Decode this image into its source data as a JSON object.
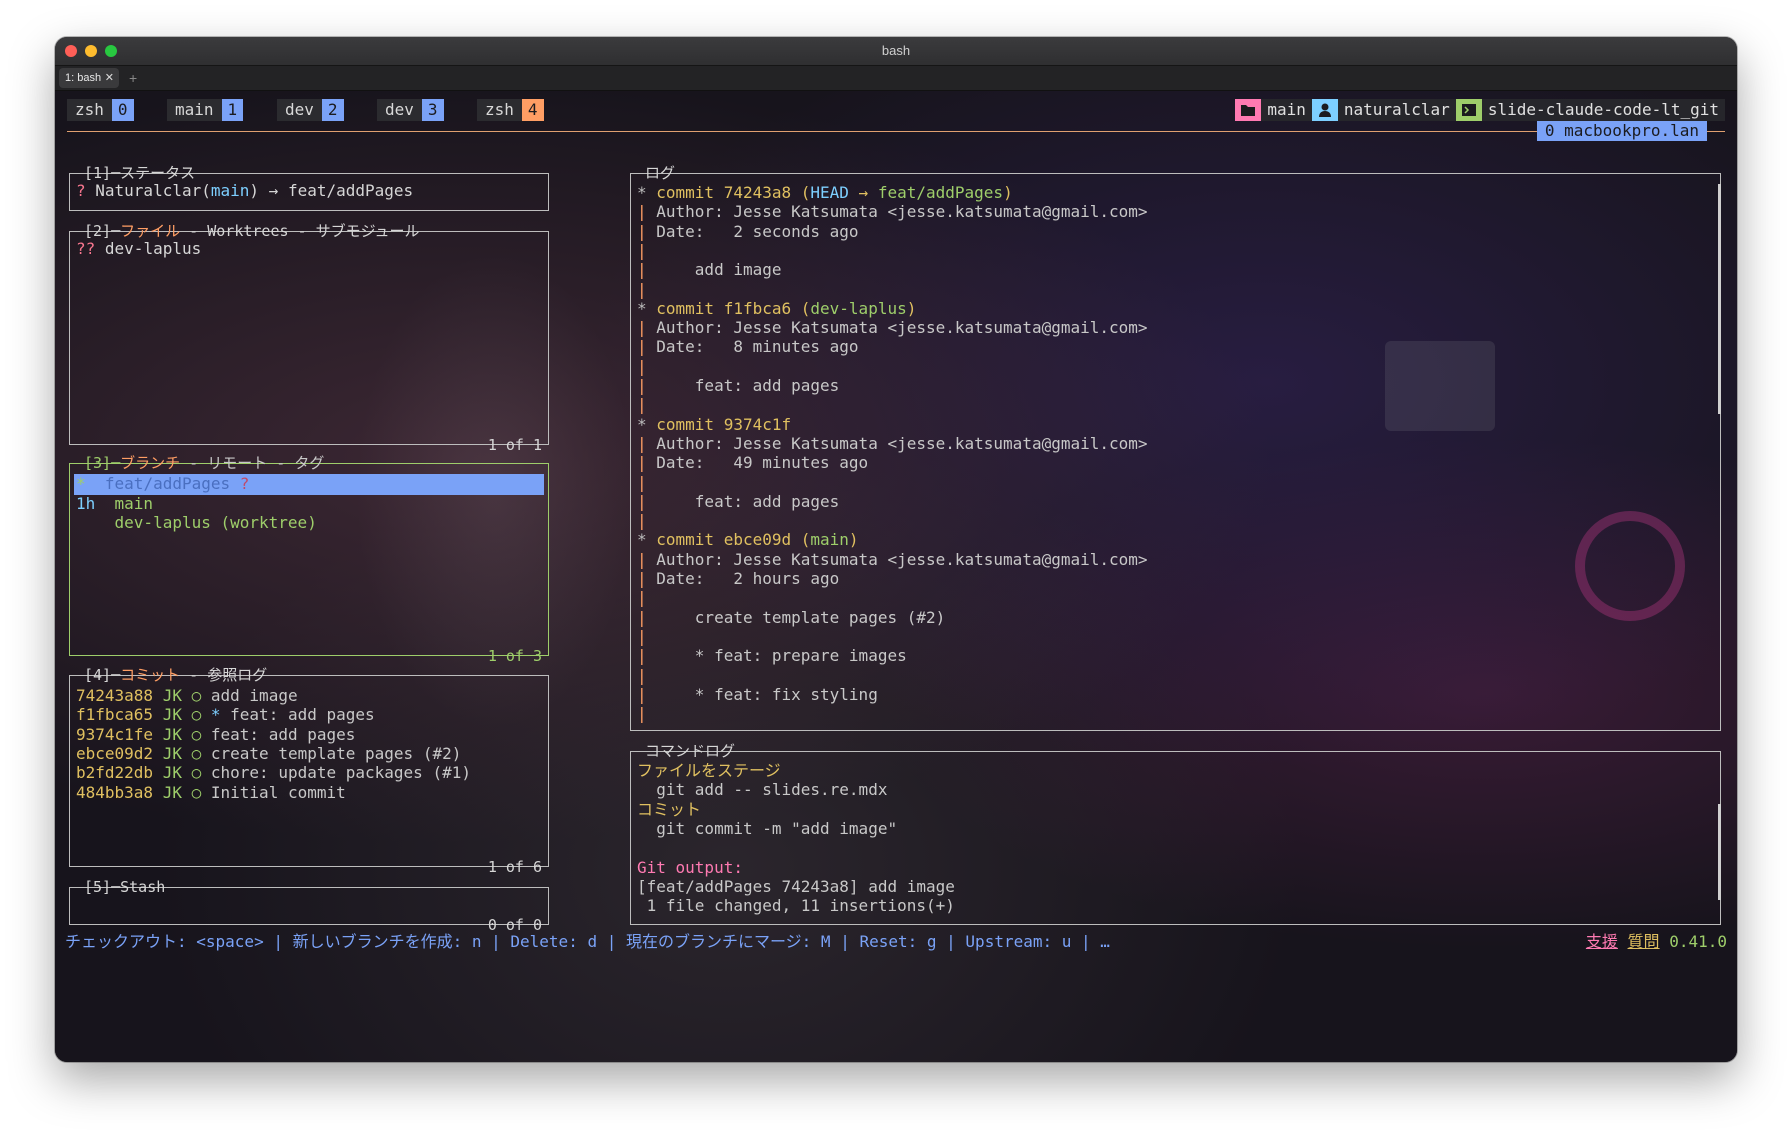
{
  "window": {
    "title": "bash",
    "tab_label": "1: bash",
    "tab_close": "✕",
    "tab_add": "+"
  },
  "tmux": {
    "windows": [
      {
        "name": "zsh",
        "index": "0"
      },
      {
        "name": "main",
        "index": "1"
      },
      {
        "name": "dev",
        "index": "2"
      },
      {
        "name": "dev",
        "index": "3"
      },
      {
        "name": "zsh",
        "index": "4",
        "active": true
      }
    ],
    "right": {
      "session": "main",
      "user": "naturalclar",
      "path": "slide-claude-code-lt_git",
      "host": "0 macbookpro.lan"
    }
  },
  "status_panel": {
    "title": "[1]─ステータス",
    "prefix": "? ",
    "repo": "Naturalclar(",
    "branch": "main",
    "close": ")",
    "arrow": " → ",
    "target": "feat/addPages"
  },
  "files_panel": {
    "title_num": "[2]─",
    "title_active": "ファイル",
    "title_rest": " - Worktrees - サブモジュール",
    "items": [
      {
        "status": "??",
        "name": "dev-laplus"
      }
    ],
    "footer": "1 of 1"
  },
  "branches_panel": {
    "title_num": "[3]─",
    "title_active": "ブランチ",
    "title_rest": " - リモート - タグ",
    "items": [
      {
        "age": "*",
        "name": "feat/addPages",
        "suffix": "?"
      },
      {
        "age": "1h",
        "name": "main",
        "suffix": ""
      },
      {
        "age": "",
        "name": "dev-laplus (worktree)",
        "suffix": ""
      }
    ],
    "footer": "1 of 3"
  },
  "commits_panel": {
    "title_num": "[4]─",
    "title_active": "コミット",
    "title_rest": " - 参照ログ",
    "items": [
      {
        "hash": "74243a88",
        "author": "JK",
        "mark": "○",
        "star": "",
        "msg": "add image"
      },
      {
        "hash": "f1fbca65",
        "author": "JK",
        "mark": "○",
        "star": "* ",
        "msg": "feat: add pages"
      },
      {
        "hash": "9374c1fe",
        "author": "JK",
        "mark": "○",
        "star": "",
        "msg": "feat: add pages"
      },
      {
        "hash": "ebce09d2",
        "author": "JK",
        "mark": "○",
        "star": "",
        "msg": "create template pages (#2)"
      },
      {
        "hash": "b2fd22db",
        "author": "JK",
        "mark": "○",
        "star": "",
        "msg": "chore: update packages (#1)"
      },
      {
        "hash": "484bb3a8",
        "author": "JK",
        "mark": "○",
        "star": "",
        "msg": "Initial commit"
      }
    ],
    "footer": "1 of 6"
  },
  "stash_panel": {
    "title": "[5]─Stash",
    "footer": "0 of 0"
  },
  "log_panel": {
    "title": "ログ",
    "lines": [
      {
        "g": "* ",
        "parts": [
          {
            "t": "commit 74243a8 (",
            "c": "yellow"
          },
          {
            "t": "HEAD",
            "c": "cyan"
          },
          {
            "t": " → ",
            "c": "yellow"
          },
          {
            "t": "feat/addPages",
            "c": "green"
          },
          {
            "t": ")",
            "c": "yellow"
          }
        ]
      },
      {
        "g": "| ",
        "parts": [
          {
            "t": "Author: Jesse Katsumata <jesse.katsumata@gmail.com>",
            "c": "dim"
          }
        ]
      },
      {
        "g": "| ",
        "parts": [
          {
            "t": "Date:   2 seconds ago",
            "c": "dim"
          }
        ]
      },
      {
        "g": "| ",
        "parts": []
      },
      {
        "g": "| ",
        "parts": [
          {
            "t": "    add image",
            "c": "dim"
          }
        ]
      },
      {
        "g": "| ",
        "parts": []
      },
      {
        "g": "* ",
        "parts": [
          {
            "t": "commit f1fbca6 (",
            "c": "yellow"
          },
          {
            "t": "dev-laplus",
            "c": "green"
          },
          {
            "t": ")",
            "c": "yellow"
          }
        ]
      },
      {
        "g": "| ",
        "parts": [
          {
            "t": "Author: Jesse Katsumata <jesse.katsumata@gmail.com>",
            "c": "dim"
          }
        ]
      },
      {
        "g": "| ",
        "parts": [
          {
            "t": "Date:   8 minutes ago",
            "c": "dim"
          }
        ]
      },
      {
        "g": "| ",
        "parts": []
      },
      {
        "g": "| ",
        "parts": [
          {
            "t": "    feat: add pages",
            "c": "dim"
          }
        ]
      },
      {
        "g": "| ",
        "parts": []
      },
      {
        "g": "* ",
        "parts": [
          {
            "t": "commit 9374c1f",
            "c": "yellow"
          }
        ]
      },
      {
        "g": "| ",
        "parts": [
          {
            "t": "Author: Jesse Katsumata <jesse.katsumata@gmail.com>",
            "c": "dim"
          }
        ]
      },
      {
        "g": "| ",
        "parts": [
          {
            "t": "Date:   49 minutes ago",
            "c": "dim"
          }
        ]
      },
      {
        "g": "| ",
        "parts": []
      },
      {
        "g": "| ",
        "parts": [
          {
            "t": "    feat: add pages",
            "c": "dim"
          }
        ]
      },
      {
        "g": "| ",
        "parts": []
      },
      {
        "g": "* ",
        "parts": [
          {
            "t": "commit ebce09d (",
            "c": "yellow"
          },
          {
            "t": "main",
            "c": "green"
          },
          {
            "t": ")",
            "c": "yellow"
          }
        ]
      },
      {
        "g": "| ",
        "parts": [
          {
            "t": "Author: Jesse Katsumata <jesse.katsumata@gmail.com>",
            "c": "dim"
          }
        ]
      },
      {
        "g": "| ",
        "parts": [
          {
            "t": "Date:   2 hours ago",
            "c": "dim"
          }
        ]
      },
      {
        "g": "| ",
        "parts": []
      },
      {
        "g": "| ",
        "parts": [
          {
            "t": "    create template pages (#2)",
            "c": "dim"
          }
        ]
      },
      {
        "g": "| ",
        "parts": []
      },
      {
        "g": "| ",
        "parts": [
          {
            "t": "    * feat: prepare images",
            "c": "dim"
          }
        ]
      },
      {
        "g": "| ",
        "parts": []
      },
      {
        "g": "| ",
        "parts": [
          {
            "t": "    * feat: fix styling",
            "c": "dim"
          }
        ]
      },
      {
        "g": "| ",
        "parts": []
      }
    ]
  },
  "cmdlog_panel": {
    "title": "コマンドログ",
    "lines": [
      {
        "t": "ファイルをステージ",
        "c": "yellow"
      },
      {
        "t": "  git add -- slides.re.mdx",
        "c": "dim"
      },
      {
        "t": "コミット",
        "c": "yellow"
      },
      {
        "t": "  git commit -m \"add image\"",
        "c": "dim"
      },
      {
        "t": "",
        "c": "dim"
      },
      {
        "t": "Git output:",
        "c": "pink"
      },
      {
        "t": "[feat/addPages 74243a8] add image",
        "c": "dim"
      },
      {
        "t": " 1 file changed, 11 insertions(+)",
        "c": "dim"
      }
    ]
  },
  "bottom": {
    "keys": "チェックアウト: <space> | 新しいブランチを作成: n | Delete: d | 現在のブランチにマージ: M | Reset: g | Upstream: u | …",
    "donate": "支援",
    "ask": "質問",
    "version": "0.41.0"
  },
  "colors": {
    "accent": "#7aa2f7",
    "active_window": "#ff9e64",
    "focus_border": "#9ece6a"
  }
}
